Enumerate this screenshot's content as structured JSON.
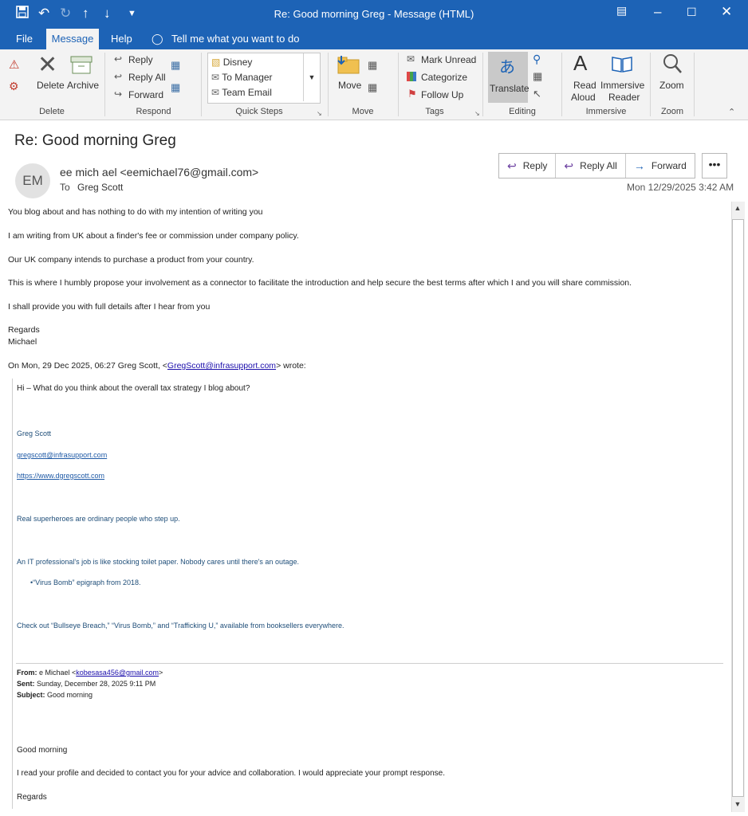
{
  "window": {
    "title": "Re: Good morning Greg  -  Message (HTML)"
  },
  "menu": {
    "file": "File",
    "message": "Message",
    "help": "Help",
    "tell_me": "Tell me what you want to do"
  },
  "ribbon": {
    "delete_group": "Delete",
    "delete_label": "Delete",
    "archive_label": "Archive",
    "respond_group": "Respond",
    "reply": "Reply",
    "reply_all": "Reply All",
    "forward": "Forward",
    "quicksteps_group": "Quick Steps",
    "quicksteps": [
      "Disney",
      "To Manager",
      "Team Email"
    ],
    "move_group": "Move",
    "move_label": "Move",
    "tags_group": "Tags",
    "mark_unread": "Mark Unread",
    "categorize": "Categorize",
    "follow_up": "Follow Up",
    "editing_group": "Editing",
    "translate": "Translate",
    "immersive_group": "Immersive",
    "read_aloud_1": "Read",
    "read_aloud_2": "Aloud",
    "immersive_reader_1": "Immersive",
    "immersive_reader_2": "Reader",
    "zoom_group": "Zoom",
    "zoom_label": "Zoom"
  },
  "message": {
    "subject": "Re: Good morning Greg",
    "avatar_initials": "EM",
    "sender": "ee mich ael <eemichael76@gmail.com>",
    "to_label": "To",
    "to_name": "Greg Scott",
    "datetime": "Mon 12/29/2025 3:42 AM",
    "actions": {
      "reply": "Reply",
      "reply_all": "Reply All",
      "forward": "Forward",
      "more": "•••"
    }
  },
  "body": {
    "lines": [
      "You blog about and has nothing to do with my intention of writing you",
      "I am writing from UK about  a finder's fee or commission under company policy.",
      "Our UK company intends to purchase a product from your country.",
      "This is where I humbly propose your involvement as a connector to facilitate the introduction and help secure the best terms after which I and you will share commission.",
      "I shall provide you with full details after I hear from you",
      "Regards",
      "Michael"
    ],
    "wrote_prefix": "On Mon, 29 Dec 2025, 06:27 Greg Scott, <",
    "wrote_email": "GregScott@infrasupport.com",
    "wrote_suffix": "> wrote:"
  },
  "quote": {
    "line1": "Hi – What do you think about the overall tax strategy I blog about?",
    "sig_name": "Greg Scott",
    "sig_email": "gregscott@infrasupport.com",
    "sig_url": "https://www.dgregscott.com",
    "tagline1": "Real superheroes are ordinary people who step up.",
    "tagline2": "An IT professional's job is like stocking toilet paper. Nobody cares until there's an outage.",
    "bullet": "“Virus Bomb” epigraph from 2018.",
    "books": "Check out “Bullseye Breach,” “Virus Bomb,” and “Trafficking U,” available from booksellers everywhere.",
    "from_label": "From:",
    "from_name": " e Michael <",
    "from_email": "kobesasa456@gmail.com",
    "from_end": ">",
    "sent_label": "Sent:",
    "sent_value": " Sunday, December 28, 2025 9:11 PM",
    "subject_label": "Subject:",
    "subject_value": " Good morning",
    "orig_line1": "Good morning",
    "orig_line2": "I read your profile and decided to contact you for your advice and collaboration.  I would appreciate your prompt response.",
    "orig_line3": "Regards"
  }
}
